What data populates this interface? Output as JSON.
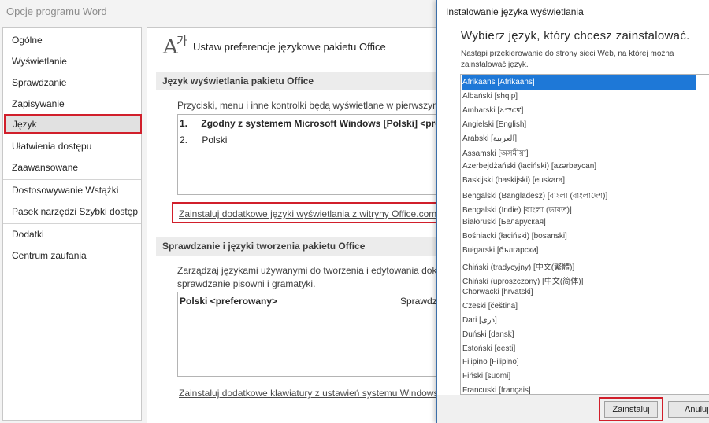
{
  "word_options": {
    "title": "Opcje programu Word",
    "nav": {
      "items": [
        "Ogólne",
        "Wyświetlanie",
        "Sprawdzanie",
        "Zapisywanie",
        "Język",
        "Ułatwienia dostępu",
        "Zaawansowane",
        "Dostosowywanie Wstążki",
        "Pasek narzędzi Szybki dostęp",
        "Dodatki",
        "Centrum zaufania"
      ],
      "selected": "Język"
    },
    "content": {
      "icon": "language-icon",
      "icon_glyph_big": "A",
      "icon_glyph_small": "가",
      "heading": "Ustaw preferencje językowe pakietu Office",
      "display_section": {
        "title": "Język wyświetlania pakietu Office",
        "description": "Przyciski, menu i inne kontrolki będą wyświetlane w pierwszym",
        "languages": [
          {
            "num": "1.",
            "text": "Zgodny z systemem Microsoft Windows [Polski] <prefe"
          },
          {
            "num": "2.",
            "text": "Polski"
          }
        ],
        "install_link": "Zainstaluj dodatkowe języki wyświetlania z witryny Office.com"
      },
      "proofing_section": {
        "title": "Sprawdzanie i języki tworzenia pakietu Office",
        "description_line1": "Zarządzaj językami używanymi do tworzenia i edytowania doku",
        "description_line2": "sprawdzanie pisowni i gramatyki.",
        "languages": [
          {
            "name": "Polski <preferowany>",
            "status": "Sprawdza"
          }
        ],
        "keyboard_link": "Zainstaluj dodatkowe klawiatury z ustawień systemu Windows"
      }
    }
  },
  "install_dialog": {
    "title": "Instalowanie języka wyświetlania",
    "heading": "Wybierz język, który chcesz zainstalować.",
    "info": "Nastąpi przekierowanie do strony sieci Web, na której można zainstalować język.",
    "selected": "Afrikaans [Afrikaans]",
    "languages": [
      "Afrikaans [Afrikaans]",
      "Albański [shqip]",
      "Amharski [አማርኛ]",
      "Angielski [English]",
      "Arabski [العربية]",
      "Assamski [অসমীয়া]",
      "Azerbejdżański (łaciński) [azərbaycan]",
      "Baskijski (baskijski) [euskara]",
      "Bengalski (Bangladesz) [বাংলা (বাংলাদেশ)]",
      "Bengalski (Indie) [বাংলা (ভারত)]",
      "Białoruski [Беларуская]",
      "Bośniacki (łaciński) [bosanski]",
      "Bułgarski [български]",
      "Chiński (tradycyjny) [中文(繁體)]",
      "Chiński (uproszczony) [中文(简体)]",
      "Chorwacki [hrvatski]",
      "Czeski [čeština]",
      "Dari [دری]",
      "Duński [dansk]",
      "Estoński [eesti]",
      "Filipino [Filipino]",
      "Fiński [suomi]",
      "Francuski [français]"
    ],
    "buttons": {
      "install": "Zainstaluj",
      "cancel": "Anuluj"
    }
  }
}
